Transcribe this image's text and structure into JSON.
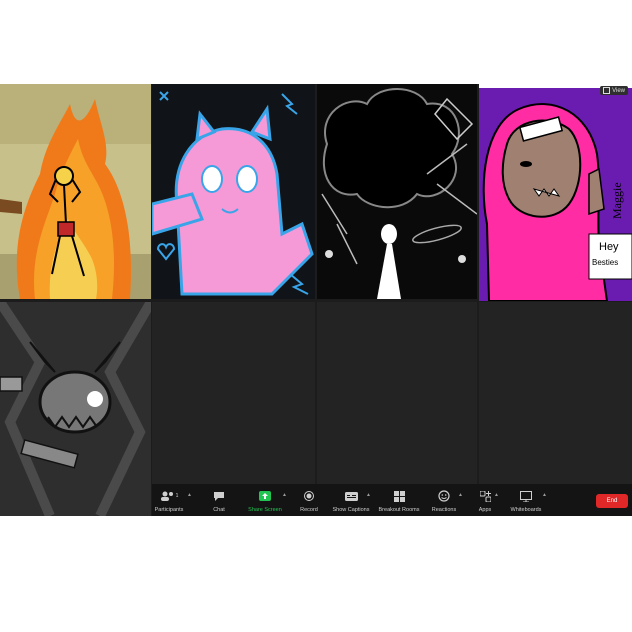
{
  "tiles": [
    {
      "id": "tile-1",
      "kind": "drawing",
      "desc": "fire"
    },
    {
      "id": "tile-2",
      "kind": "drawing",
      "desc": "pink-cat"
    },
    {
      "id": "tile-3",
      "kind": "drawing",
      "desc": "black-white"
    },
    {
      "id": "tile-4",
      "kind": "drawing",
      "desc": "pink-hoodie",
      "sign_text": [
        "Hey",
        "Besties"
      ],
      "signature": "Maggie",
      "view_label": "View"
    },
    {
      "id": "tile-5",
      "kind": "drawing",
      "desc": "skull-demon"
    }
  ],
  "toolbar": {
    "items": [
      {
        "label": "Participants",
        "count": "1",
        "icon": "participants-icon"
      },
      {
        "label": "Chat",
        "icon": "chat-icon"
      },
      {
        "label": "Share Screen",
        "icon": "share-screen-icon"
      },
      {
        "label": "Record",
        "icon": "record-icon"
      },
      {
        "label": "Show Captions",
        "icon": "captions-icon"
      },
      {
        "label": "Breakout Rooms",
        "icon": "breakout-rooms-icon"
      },
      {
        "label": "Reactions",
        "icon": "reactions-icon"
      },
      {
        "label": "Apps",
        "icon": "apps-icon"
      },
      {
        "label": "Whiteboards",
        "icon": "whiteboards-icon"
      }
    ],
    "end_label": "End"
  },
  "colors": {
    "share_screen": "#23c552",
    "end": "#e02828",
    "window_bg": "#1c1c1c",
    "tile_bg": "#232323"
  }
}
